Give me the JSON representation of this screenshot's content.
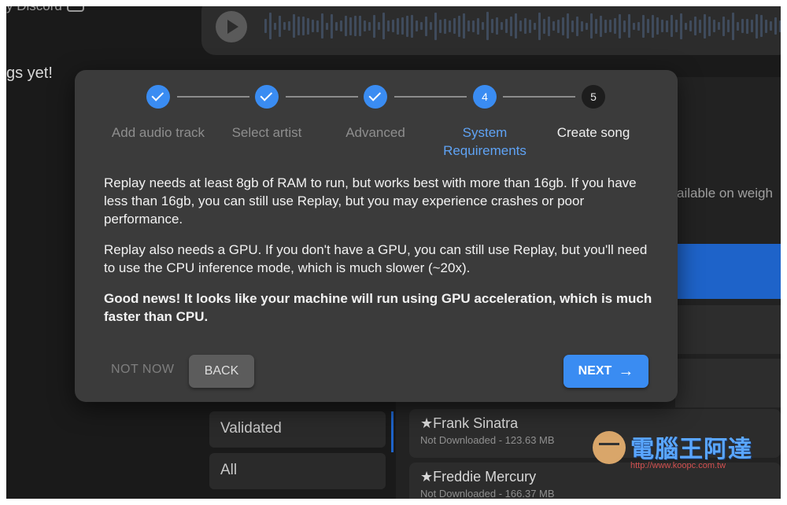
{
  "background": {
    "discord_text": "y Discord",
    "songs_text": "gs yet!",
    "weights_text": "ailable on weigh",
    "filters": [
      "Validated",
      "All"
    ],
    "songs": [
      {
        "name": "Frank Sinatra",
        "status": "Not Downloaded - 123.63 MB"
      },
      {
        "name": "Freddie Mercury",
        "status": "Not Downloaded - 166.37 MB"
      }
    ],
    "star_glyph": "★"
  },
  "watermark": {
    "title": "電腦王阿達",
    "url": "http://www.koopc.com.tw"
  },
  "modal": {
    "steps": [
      {
        "number": "1",
        "label": "Add audio track",
        "state": "done"
      },
      {
        "number": "2",
        "label": "Select artist",
        "state": "done"
      },
      {
        "number": "3",
        "label": "Advanced",
        "state": "done"
      },
      {
        "number": "4",
        "label": "System Requirements",
        "state": "active"
      },
      {
        "number": "5",
        "label": "Create song",
        "state": "future"
      }
    ],
    "paragraph1": "Replay needs at least 8gb of RAM to run, but works best with more than 16gb. If you have less than 16gb, you can still use Replay, but you may experience crashes or poor performance.",
    "paragraph2": "Replay also needs a GPU. If you don't have a GPU, you can still use Replay, but you'll need to use the CPU inference mode, which is much slower (~20x).",
    "paragraph3": "Good news! It looks like your machine will run using GPU acceleration, which is much faster than CPU.",
    "not_now_label": "NOT NOW",
    "back_label": "BACK",
    "next_label": "NEXT",
    "next_arrow": "→"
  },
  "colors": {
    "accent": "#3a8cf2",
    "modal_bg": "#3b3b3b",
    "app_bg": "#1a1a1a"
  }
}
